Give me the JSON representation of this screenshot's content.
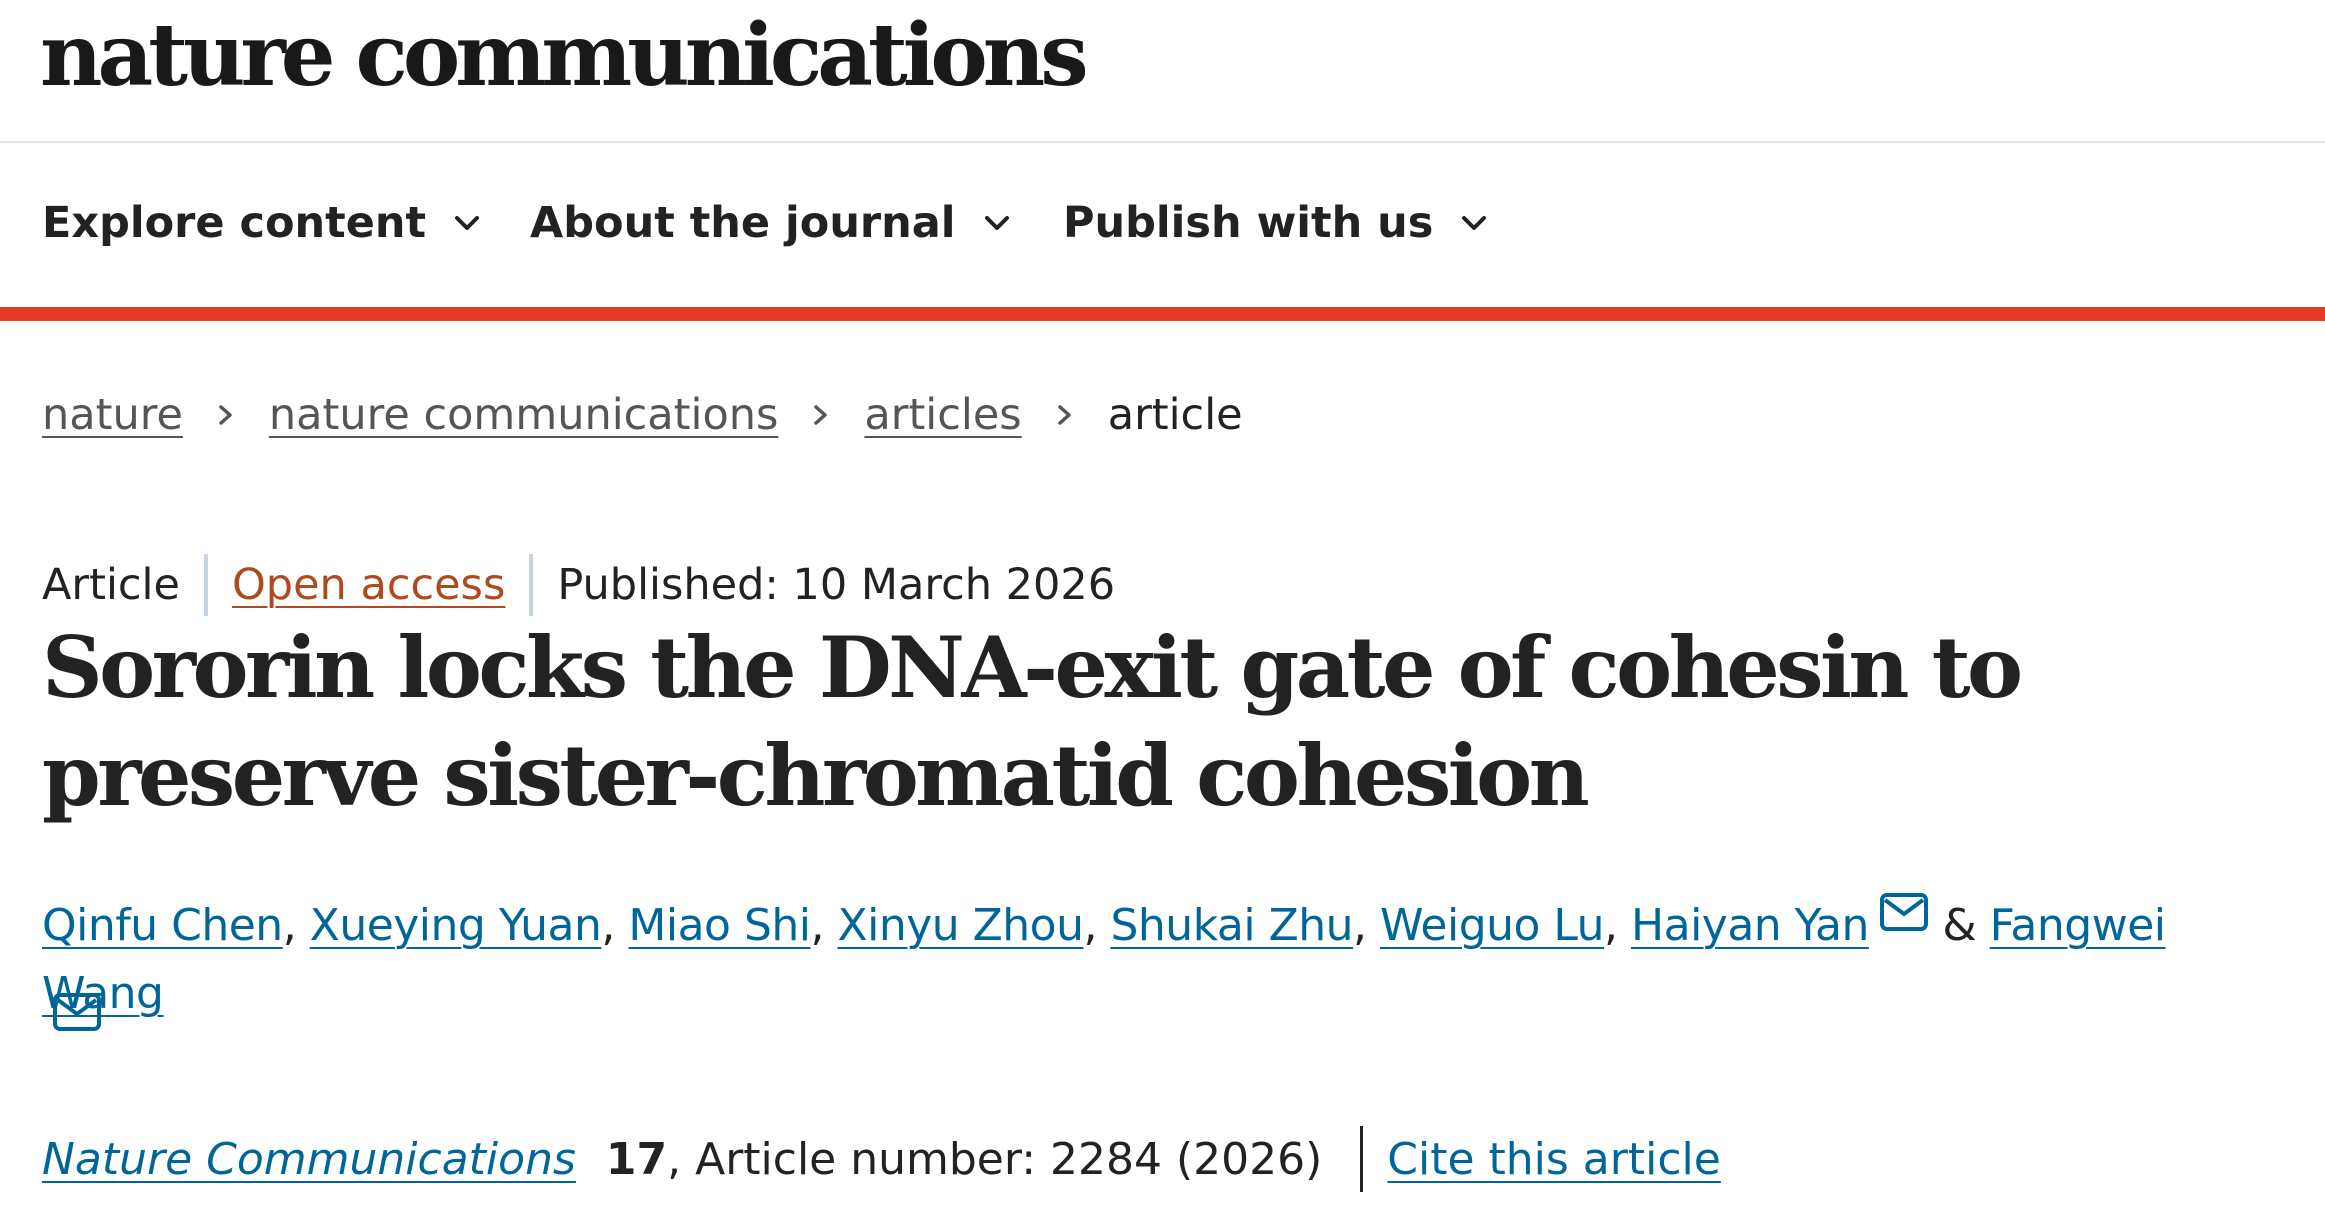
{
  "header": {
    "logo_text": "nature communications"
  },
  "nav": {
    "items": [
      {
        "label": "Explore content",
        "icon": "chevron-down-icon"
      },
      {
        "label": "About the journal",
        "icon": "chevron-down-icon"
      },
      {
        "label": "Publish with us",
        "icon": "chevron-down-icon"
      }
    ],
    "accent_color": "#e43a24"
  },
  "breadcrumb": {
    "items": [
      "nature",
      "nature communications",
      "articles"
    ],
    "current": "article",
    "separator_icon": "chevron-right-icon"
  },
  "article": {
    "type": "Article",
    "access": "Open access",
    "published": "Published: 10 March 2026",
    "title": "Sororin locks the DNA-exit gate of cohesin to preserve sister-chromatid cohesion",
    "authors": [
      {
        "name": "Qinfu Chen",
        "corresponding": false
      },
      {
        "name": "Xueying Yuan",
        "corresponding": false
      },
      {
        "name": "Miao Shi",
        "corresponding": false
      },
      {
        "name": "Xinyu Zhou",
        "corresponding": false
      },
      {
        "name": "Shukai Zhu",
        "corresponding": false
      },
      {
        "name": "Weiguo Lu",
        "corresponding": false
      },
      {
        "name": "Haiyan Yan",
        "corresponding": true
      },
      {
        "name": "Fangwei Wang",
        "corresponding": true
      }
    ],
    "author_separator": ",",
    "last_author_joiner": "&",
    "journal": "Nature Communications",
    "volume": "17",
    "article_number": ", Article number: 2284 (2026)",
    "cite_label": "Cite this article",
    "link_color": "#006699",
    "open_access_color": "#b04a1e"
  }
}
